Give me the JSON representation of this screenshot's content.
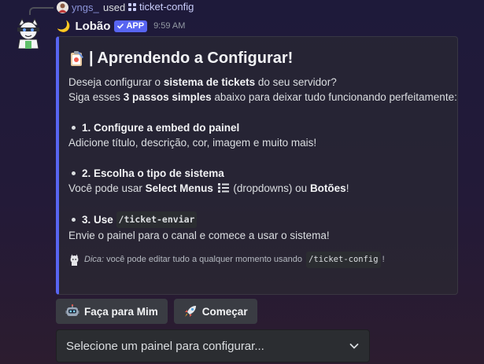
{
  "reply": {
    "username": "yngs_",
    "used_text": "used",
    "command": "ticket-config"
  },
  "message": {
    "moon_glyph": "🌙",
    "author": "Lobão",
    "app_badge": "APP",
    "timestamp": "9:59 AM"
  },
  "embed": {
    "accent_color": "#5865f2",
    "title": "| Aprendendo a Configurar!",
    "intro_line1_prefix": "Deseja configurar o ",
    "intro_line1_bold": "sistema de tickets",
    "intro_line1_suffix": " do seu servidor?",
    "intro_line2_prefix": "Siga esses ",
    "intro_line2_bold": "3 passos simples",
    "intro_line2_suffix": " abaixo para deixar tudo funcionando perfeitamente:",
    "steps": [
      {
        "heading": "1. Configure a embed do painel",
        "text": "Adicione título, descrição, cor, imagem e muito mais!"
      },
      {
        "heading": "2. Escolha o tipo de sistema",
        "text_prefix": "Você pode usar ",
        "text_bold1": "Select Menus",
        "text_middle": " (dropdowns) ou ",
        "text_bold2": "Botões",
        "text_suffix": "!"
      },
      {
        "heading_prefix": "3. Use ",
        "heading_code": "/ticket-enviar",
        "text": "Envie o painel para o canal e comece a usar o sistema!"
      }
    ],
    "tip_label": "Dica:",
    "tip_text": " você pode editar tudo a qualquer momento usando ",
    "tip_code": "/ticket-config",
    "tip_suffix": "!"
  },
  "buttons": [
    {
      "label": "Faça para Mim",
      "icon": "robot-icon"
    },
    {
      "label": "Começar",
      "icon": "rocket-icon"
    }
  ],
  "select": {
    "placeholder": "Selecione um painel para configurar..."
  }
}
